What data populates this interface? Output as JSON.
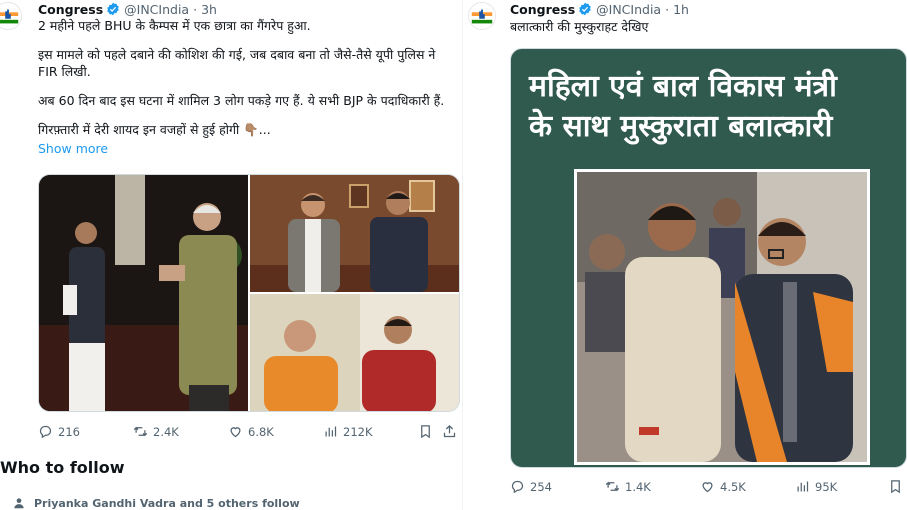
{
  "left_tweet": {
    "author": {
      "name": "Congress",
      "handle": "@INCIndia",
      "time": "3h"
    },
    "text": {
      "p1": "2 महीने पहले BHU के कैम्पस में एक छात्रा का गैंगरेप हुआ.",
      "p2": "इस मामले को पहले दबाने की कोशिश की गई, जब दबाव बना तो जैसे-तैसे यूपी पुलिस ने FIR लिखी.",
      "p3": "अब 60 दिन बाद इस घटना में शामिल 3 लोग पकड़े गए हैं. ये सभी BJP के पदाधिकारी हैं.",
      "p4": "गिरफ़्तारी में देरी शायद इन वजहों से हुई होगी 👇🏽...",
      "show_more": "Show more"
    },
    "stats": {
      "replies": "216",
      "reposts": "2.4K",
      "likes": "6.8K",
      "views": "212K"
    }
  },
  "right_tweet": {
    "author": {
      "name": "Congress",
      "handle": "@INCIndia",
      "time": "1h"
    },
    "text": "बलात्कारी की मुस्कुराहट देखिए",
    "poster": {
      "line1": "महिला एवं बाल विकास मंत्री",
      "line2": "के साथ मुस्कुराता बलात्कारी"
    },
    "stats": {
      "replies": "254",
      "reposts": "1.4K",
      "likes": "4.5K",
      "views": "95K"
    }
  },
  "who_to_follow": {
    "title": "Who to follow",
    "row_text": "Priyanka Gandhi Vadra and 5 others follow"
  },
  "icons": [
    "inc-logo-icon",
    "verified-badge-icon",
    "reply-icon",
    "repost-icon",
    "like-icon",
    "views-icon",
    "bookmark-icon",
    "share-icon",
    "person-icon"
  ],
  "colors": {
    "accent": "#1d9bf0",
    "muted": "#536471",
    "poster_green": "#315a4e"
  }
}
